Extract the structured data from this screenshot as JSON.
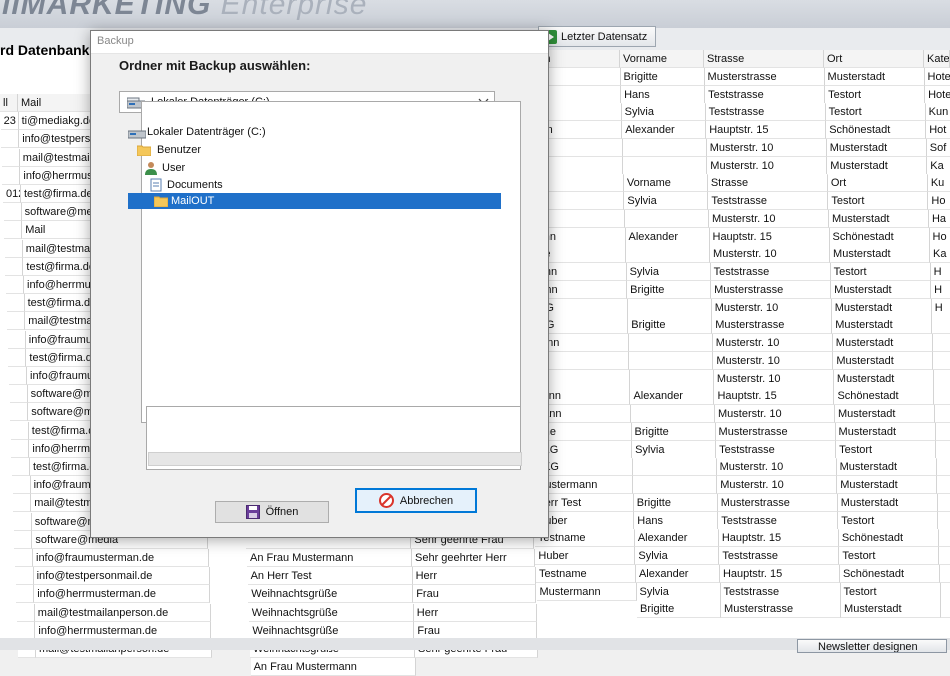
{
  "app": {
    "title": "MARKETING",
    "title_prefix": "ii",
    "title_sub": "Enterprise",
    "db_title": "rd Datenbank",
    "last_record_label": "Letzter Datensatz",
    "newsletter_label": "Newsletter designen"
  },
  "grid": {
    "col_a": [
      "ll",
      "23",
      "",
      "",
      "",
      "012",
      "",
      "",
      "",
      "",
      "",
      "",
      "",
      "",
      "",
      "",
      "",
      "",
      "",
      "",
      "",
      "",
      "",
      "",
      "",
      "",
      "",
      "",
      "",
      "",
      ""
    ],
    "col_mail": [
      "Mail",
      "ti@mediakg.de",
      "info@testperson",
      "mail@testmailan",
      "info@herrmuster",
      "test@firma.de",
      "software@media",
      "Mail",
      "mail@testmailan",
      "test@firma.de",
      "info@herrmuster",
      "test@firma.de",
      "mail@testmailan",
      "info@fraumuster",
      "test@firma.de",
      "info@fraumuster",
      "software@media",
      "software@media",
      "test@firma.de",
      "info@herrmuster",
      "test@firma.de",
      "info@fraumuster",
      "mail@testmailan",
      "software@media",
      "software@media",
      "info@fraumusterman.de",
      "info@testpersonmail.de",
      "info@herrmusterman.de",
      "mail@testmailanperson.de",
      "info@herrmusterman.de",
      "mail@testmailanperson.de"
    ],
    "col_anrede": [
      "",
      "",
      "",
      "",
      "",
      "",
      "",
      "",
      "",
      "",
      "",
      "",
      "",
      "",
      "",
      "",
      "",
      "",
      "",
      "",
      "",
      "",
      "",
      "",
      "",
      "An Frau Mustermann",
      "An Herr Test",
      "Weihnachtsgrüße",
      "Weihnachtsgrüße",
      "Weihnachtsgrüße",
      "Weihnachtsgrüße",
      "An Frau Mustermann"
    ],
    "col_briefanrede": [
      "",
      "",
      "",
      "",
      "",
      "",
      "",
      "",
      "",
      "",
      "",
      "",
      "",
      "",
      "",
      "",
      "",
      "",
      "",
      "",
      "",
      "",
      "",
      "",
      "Sehr geehrte Frau",
      "Sehr geehrter Herr",
      "Herr",
      "Frau",
      "Herr",
      "Frau",
      "Sehr geehrte Frau"
    ],
    "col_name": [
      "mann",
      "est",
      "ame",
      "",
      "mann",
      "AKG",
      "",
      "ame",
      "",
      "",
      "mann",
      "ame",
      "mann",
      "mann",
      "AKG",
      "AKG",
      "mann",
      "",
      "",
      "mann",
      "mann",
      "ame",
      "AKG",
      "AKG",
      "Mustermann",
      "Herr Test",
      "Huber",
      "Testname",
      "Huber",
      "Testname",
      "Mustermann"
    ],
    "col_vorname": [
      "Vorname",
      "Brigitte",
      "Hans",
      "Sylvia",
      "Alexander",
      "",
      "",
      "Vorname",
      "Sylvia",
      "",
      "Alexander",
      "",
      "Sylvia",
      "Brigitte",
      "",
      "Brigitte",
      "",
      "",
      "",
      "Alexander",
      "",
      "Brigitte",
      "Sylvia",
      "",
      "",
      "Brigitte",
      "Hans",
      "Alexander",
      "Sylvia",
      "Alexander",
      "Sylvia",
      "Brigitte"
    ],
    "col_strasse": [
      "Strasse",
      "Musterstrasse",
      "Teststrasse",
      "Teststrasse",
      "Hauptstr. 15",
      "Musterstr. 10",
      "Musterstr. 10",
      "Strasse",
      "Teststrasse",
      "Musterstr. 10",
      "Hauptstr. 15",
      "Musterstr. 10",
      "Teststrasse",
      "Musterstrasse",
      "Musterstr. 10",
      "Musterstrasse",
      "Musterstr. 10",
      "Musterstr. 10",
      "Musterstr. 10",
      "Hauptstr. 15",
      "Musterstr. 10",
      "Musterstrasse",
      "Teststrasse",
      "Musterstr. 10",
      "Musterstr. 10",
      "Musterstrasse",
      "Teststrasse",
      "Hauptstr. 15",
      "Teststrasse",
      "Hauptstr. 15",
      "Teststrasse",
      "Musterstrasse"
    ],
    "col_ort": [
      "Ort",
      "Musterstadt",
      "Testort",
      "Testort",
      "Schönestadt",
      "Musterstadt",
      "Musterstadt",
      "Ort",
      "Testort",
      "Musterstadt",
      "Schönestadt",
      "Musterstadt",
      "Testort",
      "Musterstadt",
      "Musterstadt",
      "Musterstadt",
      "Musterstadt",
      "Musterstadt",
      "Musterstadt",
      "Schönestadt",
      "Musterstadt",
      "Musterstadt",
      "Testort",
      "Musterstadt",
      "Musterstadt",
      "Musterstadt",
      "Testort",
      "Schönestadt",
      "Testort",
      "Schönestadt",
      "Testort",
      "Musterstadt"
    ],
    "col_kat": [
      "Kate",
      "Hote",
      "Hote",
      "Kun",
      "Hot",
      "Sof",
      "Ka",
      "Ku",
      "Ho",
      "Ha",
      "Ho",
      "Ka",
      "H",
      "H",
      "H",
      "",
      "",
      "",
      "",
      "",
      "",
      "",
      "",
      "",
      "",
      "",
      "",
      "",
      "",
      "",
      "",
      ""
    ]
  },
  "dialog": {
    "title": "Backup",
    "folder_label": "Ordner mit Backup auswählen:",
    "drive_selected": "Lokaler Datenträger (C:)",
    "tree": [
      {
        "label": "Lokaler Datenträger (C:)",
        "icon": "drive-icon"
      },
      {
        "label": "Benutzer",
        "icon": "folder-icon"
      },
      {
        "label": "User",
        "icon": "user-icon"
      },
      {
        "label": "Documents",
        "icon": "documents-icon"
      },
      {
        "label": "MailOUT",
        "icon": "folder-icon",
        "selected": true
      }
    ],
    "path_value": "",
    "progress": 0,
    "open_label": "Öffnen",
    "cancel_label": "Abbrechen"
  },
  "colors": {
    "selection": "#1f70c9",
    "accent_button_border": "#0078d7",
    "cancel_icon": "#d9342b",
    "save_icon": "#6a3d9a",
    "play_icon": "#2f8f3a"
  }
}
